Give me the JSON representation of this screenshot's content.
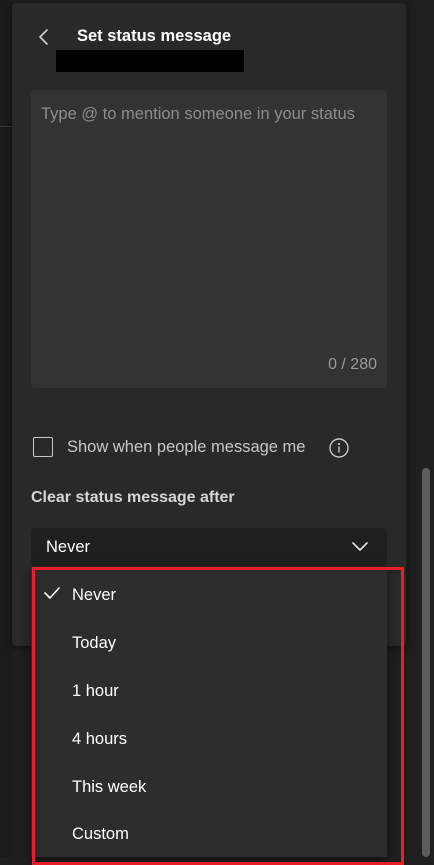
{
  "dialog": {
    "title": "Set status message",
    "back_icon": "chevron-left-icon"
  },
  "status_input": {
    "value": "",
    "placeholder": "Type @ to mention someone in your status",
    "counter": "0 / 280"
  },
  "show_when_messaged": {
    "label": "Show when people message me",
    "checked": false,
    "info_icon": "info-icon"
  },
  "clear_after": {
    "label": "Clear status message after",
    "selected": "Never",
    "chevron_icon": "chevron-down-icon",
    "options": [
      {
        "label": "Never",
        "selected": true
      },
      {
        "label": "Today",
        "selected": false
      },
      {
        "label": "1 hour",
        "selected": false
      },
      {
        "label": "4 hours",
        "selected": false
      },
      {
        "label": "This week",
        "selected": false
      },
      {
        "label": "Custom",
        "selected": false
      }
    ]
  },
  "colors": {
    "panel_bg": "#292929",
    "input_bg": "#333333",
    "menu_bg": "#2d2d2d",
    "highlight": "#e81e2b"
  }
}
